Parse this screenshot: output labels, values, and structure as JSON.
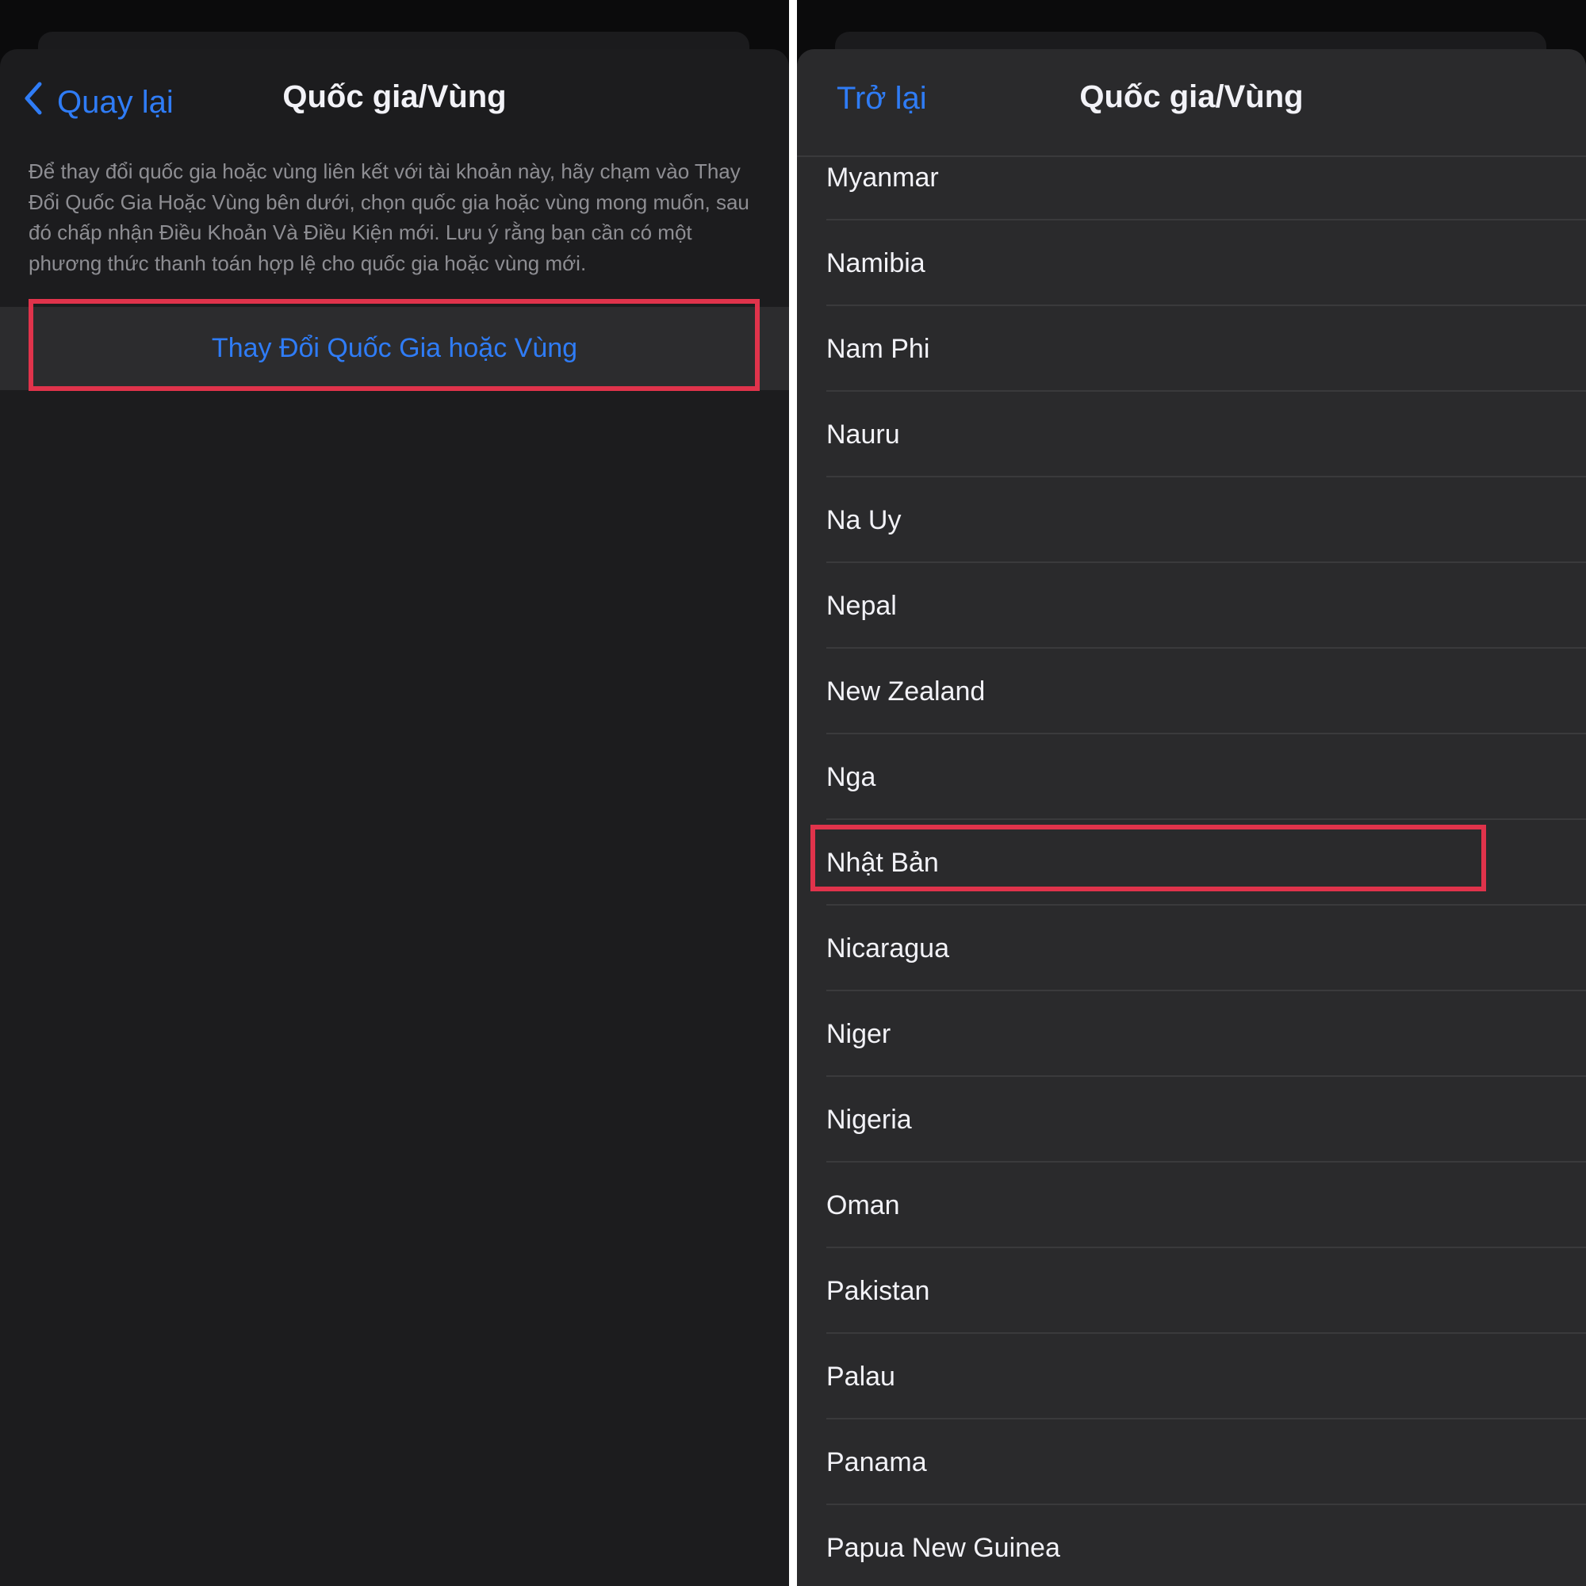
{
  "left_screen": {
    "back_label": "Quay lại",
    "title": "Quốc gia/Vùng",
    "description": "Để thay đổi quốc gia hoặc vùng liên kết với tài khoản này, hãy chạm vào Thay Đổi Quốc Gia Hoặc Vùng bên dưới, chọn quốc gia hoặc vùng mong muốn, sau đó chấp nhận Điều Khoản Và Điều Kiện mới. Lưu ý rằng bạn cần có một phương thức thanh toán hợp lệ cho quốc gia hoặc vùng mới.",
    "change_button": "Thay Đổi Quốc Gia hoặc Vùng"
  },
  "right_screen": {
    "back_label": "Trở lại",
    "title": "Quốc gia/Vùng",
    "countries": [
      "Myanmar",
      "Namibia",
      "Nam Phi",
      "Nauru",
      "Na Uy",
      "Nepal",
      "New Zealand",
      "Nga",
      "Nhật Bản",
      "Nicaragua",
      "Niger",
      "Nigeria",
      "Oman",
      "Pakistan",
      "Palau",
      "Panama",
      "Papua New Guinea"
    ],
    "highlighted_country": "Nhật Bản"
  },
  "colors": {
    "accent": "#2f7cf6",
    "highlight_box": "#e0334b",
    "background": "#1c1c1e",
    "text_primary": "#f2f2f7",
    "text_secondary": "#8e8e93"
  }
}
